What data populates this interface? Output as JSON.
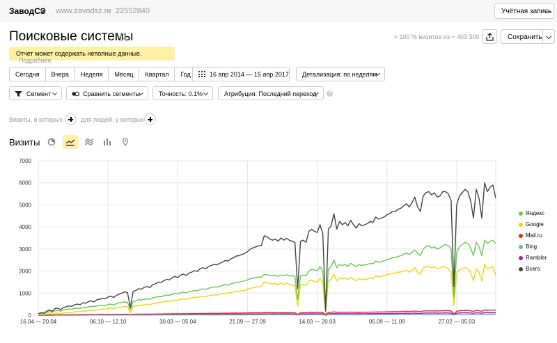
{
  "topbar": {
    "site_name": "ЗаводСЗ",
    "site_url": "www.zavodsz.ru",
    "counter_id": "22552840",
    "account_label": "Учётная запись"
  },
  "header": {
    "title": "Поисковые системы",
    "visits_summary": "≈ 100 % визитов из ≈ 403 300",
    "save_label": "Сохранить"
  },
  "warning": {
    "text": "Отчет может содержать неполные данные.",
    "link": "Подробнее"
  },
  "period": {
    "buttons": [
      "Сегодня",
      "Вчера",
      "Неделя",
      "Месяц",
      "Квартал",
      "Год"
    ],
    "date_range": "16 апр 2014 — 15 апр 2017",
    "detail": "Детализация: по неделям"
  },
  "segments": {
    "segment": "Сегмент",
    "compare": "Сравнить сегменты",
    "accuracy": "Точность: 0.1%",
    "attribution": "Атрибуция: Последний переход"
  },
  "filters": {
    "visits_where": "Визиты, в которых",
    "people_where": "для людей, у которых"
  },
  "metric_title": "Визиты",
  "chart_data": {
    "type": "line",
    "y_ticks": [
      "0",
      "1000",
      "2000",
      "3000",
      "4000",
      "5000",
      "6000",
      "7000"
    ],
    "ylim": [
      0,
      7000
    ],
    "x_tick_labels": [
      "16.04 — 20.04",
      "06.10 — 12.10",
      "30.03 — 05.04",
      "21.09 — 27.09",
      "14.03 — 20.03",
      "05.09 — 11.09",
      "27.02 — 05.03"
    ],
    "x_tick_index": [
      0,
      25,
      50,
      75,
      100,
      125,
      150
    ],
    "grid": true,
    "legend_position": "right",
    "series": [
      {
        "name": "Всего",
        "color": "#444444",
        "values": [
          70,
          110,
          90,
          180,
          230,
          180,
          300,
          320,
          250,
          350,
          380,
          420,
          400,
          470,
          500,
          480,
          560,
          540,
          620,
          650,
          600,
          700,
          720,
          760,
          740,
          820,
          860,
          800,
          900,
          960,
          1000,
          1060,
          1020,
          350,
          1080,
          1120,
          1200,
          1180,
          1260,
          1300,
          1250,
          1380,
          1420,
          1500,
          1480,
          1560,
          1620,
          1600,
          1700,
          1760,
          1700,
          1820,
          1860,
          1800,
          1900,
          1950,
          2020,
          1980,
          2100,
          2150,
          2100,
          2200,
          2250,
          2300,
          2280,
          2350,
          2400,
          2480,
          2450,
          2550,
          2600,
          2680,
          2700,
          2750,
          2800,
          2880,
          3000,
          3050,
          3100,
          3150,
          3150,
          3600,
          3550,
          3450,
          3400,
          3450,
          3350,
          3500,
          3400,
          3480,
          3400,
          3350,
          3300,
          1200,
          3350,
          3400,
          3300,
          3800,
          3900,
          3800,
          3750,
          4100,
          3700,
          200,
          3900,
          4050,
          4600,
          3900,
          4250,
          4100,
          4200,
          4050,
          4300,
          4100,
          3950,
          4150,
          4050,
          4100,
          4150,
          4250,
          4200,
          4450,
          4350,
          4400,
          4450,
          4550,
          4600,
          4700,
          4700,
          4800,
          4850,
          4950,
          5050,
          4900,
          5100,
          5350,
          4900,
          4700,
          5400,
          5550,
          5600,
          5450,
          5550,
          5350,
          5400,
          5600,
          5600,
          5500,
          5200,
          1300,
          5000,
          5400,
          5550,
          5700,
          5600,
          5200,
          4400,
          5700,
          5300,
          4400,
          6000,
          5600,
          5800,
          5900,
          5300
        ]
      },
      {
        "name": "Яндекс",
        "color": "#65c94d",
        "values": [
          50,
          80,
          60,
          120,
          160,
          130,
          200,
          220,
          180,
          240,
          260,
          280,
          270,
          300,
          320,
          310,
          350,
          340,
          380,
          400,
          390,
          420,
          430,
          450,
          440,
          480,
          500,
          470,
          520,
          560,
          580,
          600,
          580,
          250,
          620,
          650,
          700,
          690,
          720,
          740,
          720,
          790,
          800,
          850,
          840,
          880,
          910,
          900,
          950,
          980,
          960,
          1010,
          1040,
          1010,
          1060,
          1090,
          1120,
          1100,
          1170,
          1190,
          1170,
          1220,
          1250,
          1280,
          1270,
          1310,
          1340,
          1380,
          1360,
          1420,
          1450,
          1490,
          1500,
          1530,
          1560,
          1600,
          1650,
          1680,
          1700,
          1730,
          1720,
          1850,
          1830,
          1800,
          1780,
          1800,
          1760,
          1820,
          1790,
          1830,
          1800,
          1780,
          1760,
          700,
          1780,
          1820,
          1780,
          2000,
          2080,
          2050,
          2020,
          2200,
          2000,
          150,
          2100,
          2200,
          2500,
          2150,
          2300,
          2250,
          2300,
          2220,
          2350,
          2270,
          2200,
          2300,
          2250,
          2280,
          2300,
          2350,
          2330,
          2450,
          2400,
          2430,
          2470,
          2520,
          2550,
          2600,
          2620,
          2660,
          2700,
          2760,
          2820,
          2750,
          2850,
          2950,
          2800,
          2700,
          3000,
          3100,
          3150,
          3050,
          3100,
          3000,
          3050,
          3150,
          3200,
          3150,
          3000,
          800,
          2850,
          3100,
          3200,
          3300,
          3250,
          3050,
          2700,
          3300,
          3100,
          2700,
          3400,
          3250,
          3350,
          3400,
          3250
        ]
      },
      {
        "name": "Google",
        "color": "#f5d30a",
        "values": [
          15,
          25,
          20,
          50,
          60,
          40,
          80,
          90,
          60,
          100,
          110,
          130,
          120,
          150,
          160,
          150,
          190,
          180,
          210,
          230,
          200,
          250,
          260,
          280,
          270,
          300,
          320,
          290,
          330,
          350,
          370,
          400,
          380,
          100,
          400,
          420,
          450,
          440,
          480,
          500,
          480,
          520,
          540,
          580,
          570,
          610,
          630,
          620,
          660,
          680,
          660,
          720,
          740,
          710,
          760,
          780,
          820,
          800,
          840,
          860,
          840,
          880,
          900,
          920,
          910,
          950,
          970,
          1000,
          990,
          1030,
          1050,
          1080,
          1090,
          1110,
          1130,
          1160,
          1220,
          1240,
          1270,
          1290,
          1300,
          1500,
          1480,
          1430,
          1410,
          1430,
          1380,
          1450,
          1400,
          1440,
          1400,
          1370,
          1350,
          400,
          1380,
          1400,
          1350,
          1560,
          1580,
          1520,
          1500,
          1660,
          1480,
          80,
          1560,
          1620,
          1860,
          1550,
          1700,
          1640,
          1680,
          1610,
          1720,
          1630,
          1560,
          1660,
          1600,
          1620,
          1640,
          1690,
          1660,
          1780,
          1740,
          1760,
          1790,
          1840,
          1860,
          1900,
          1900,
          1940,
          1960,
          2000,
          2040,
          1950,
          2040,
          2160,
          1940,
          1850,
          2140,
          2200,
          2200,
          2150,
          2200,
          2100,
          2130,
          2200,
          2170,
          2110,
          1950,
          450,
          1900,
          2050,
          2100,
          2150,
          2100,
          1950,
          1550,
          2100,
          1950,
          1550,
          2300,
          2100,
          2150,
          2200,
          1800
        ]
      },
      {
        "name": "Mail.ru",
        "color": "#e02b27",
        "values": [
          3,
          4,
          4,
          6,
          8,
          6,
          10,
          12,
          8,
          14,
          15,
          16,
          15,
          18,
          20,
          19,
          22,
          21,
          24,
          26,
          24,
          28,
          29,
          30,
          29,
          32,
          34,
          30,
          35,
          38,
          40,
          42,
          40,
          15,
          42,
          44,
          46,
          45,
          48,
          50,
          48,
          52,
          54,
          56,
          55,
          58,
          60,
          59,
          62,
          64,
          62,
          66,
          68,
          66,
          70,
          72,
          74,
          73,
          76,
          78,
          77,
          80,
          82,
          84,
          83,
          86,
          88,
          90,
          89,
          92,
          94,
          96,
          97,
          99,
          100,
          102,
          104,
          106,
          108,
          110,
          108,
          118,
          116,
          112,
          110,
          112,
          108,
          114,
          110,
          114,
          110,
          108,
          106,
          40,
          108,
          110,
          108,
          122,
          126,
          122,
          120,
          132,
          118,
          12,
          126,
          130,
          150,
          124,
          136,
          132,
          134,
          130,
          138,
          132,
          126,
          134,
          130,
          132,
          134,
          138,
          136,
          146,
          142,
          144,
          148,
          152,
          154,
          158,
          160,
          162,
          166,
          170,
          174,
          168,
          176,
          186,
          170,
          164,
          190,
          196,
          200,
          192,
          198,
          190,
          194,
          202,
          206,
          202,
          190,
          60,
          180,
          200,
          210,
          220,
          214,
          200,
          170,
          220,
          206,
          176,
          236,
          220,
          226,
          232,
          216
        ]
      },
      {
        "name": "Bing",
        "color": "#5fa9de",
        "values": [
          1,
          1,
          1,
          2,
          2,
          2,
          2,
          3,
          2,
          3,
          3,
          3,
          3,
          4,
          4,
          4,
          4,
          4,
          5,
          5,
          5,
          5,
          6,
          6,
          6,
          6,
          7,
          6,
          7,
          7,
          8,
          8,
          8,
          3,
          8,
          9,
          9,
          9,
          10,
          10,
          10,
          10,
          11,
          11,
          11,
          12,
          12,
          12,
          12,
          13,
          13,
          13,
          14,
          13,
          14,
          14,
          15,
          15,
          15,
          16,
          16,
          16,
          17,
          17,
          17,
          17,
          18,
          18,
          18,
          19,
          19,
          20,
          20,
          20,
          21,
          21,
          22,
          22,
          22,
          23,
          23,
          24,
          24,
          23,
          23,
          23,
          22,
          23,
          23,
          23,
          23,
          22,
          22,
          8,
          22,
          23,
          22,
          25,
          26,
          25,
          25,
          27,
          24,
          3,
          26,
          27,
          30,
          25,
          28,
          27,
          28,
          27,
          28,
          27,
          26,
          28,
          27,
          27,
          28,
          29,
          28,
          30,
          29,
          30,
          30,
          31,
          32,
          32,
          33,
          33,
          34,
          35,
          36,
          34,
          36,
          38,
          35,
          34,
          39,
          40,
          41,
          39,
          40,
          39,
          40,
          41,
          42,
          41,
          39,
          12,
          37,
          41,
          43,
          45,
          44,
          41,
          35,
          45,
          42,
          36,
          48,
          45,
          46,
          47,
          44
        ]
      },
      {
        "name": "Rambler",
        "color": "#a520a8",
        "values": [
          2,
          3,
          3,
          4,
          5,
          4,
          6,
          7,
          5,
          8,
          8,
          9,
          9,
          10,
          11,
          10,
          12,
          12,
          13,
          14,
          13,
          15,
          16,
          16,
          16,
          17,
          18,
          17,
          19,
          20,
          21,
          22,
          21,
          8,
          22,
          23,
          24,
          24,
          25,
          26,
          25,
          27,
          28,
          29,
          29,
          30,
          31,
          31,
          32,
          33,
          32,
          34,
          35,
          34,
          36,
          37,
          38,
          37,
          39,
          40,
          39,
          41,
          42,
          43,
          42,
          44,
          45,
          46,
          45,
          47,
          48,
          49,
          50,
          51,
          51,
          52,
          53,
          54,
          55,
          56,
          55,
          60,
          59,
          57,
          56,
          57,
          55,
          58,
          56,
          58,
          56,
          55,
          54,
          20,
          55,
          56,
          55,
          62,
          64,
          62,
          61,
          67,
          60,
          6,
          64,
          66,
          76,
          63,
          69,
          67,
          68,
          66,
          70,
          67,
          64,
          68,
          66,
          67,
          68,
          70,
          69,
          74,
          72,
          73,
          75,
          77,
          78,
          80,
          81,
          82,
          84,
          86,
          88,
          85,
          89,
          94,
          86,
          83,
          96,
          99,
          101,
          97,
          100,
          96,
          98,
          102,
          104,
          102,
          96,
          30,
          91,
          101,
          106,
          111,
          108,
          101,
          86,
          111,
          104,
          89,
          119,
          111,
          114,
          117,
          109
        ]
      }
    ]
  }
}
